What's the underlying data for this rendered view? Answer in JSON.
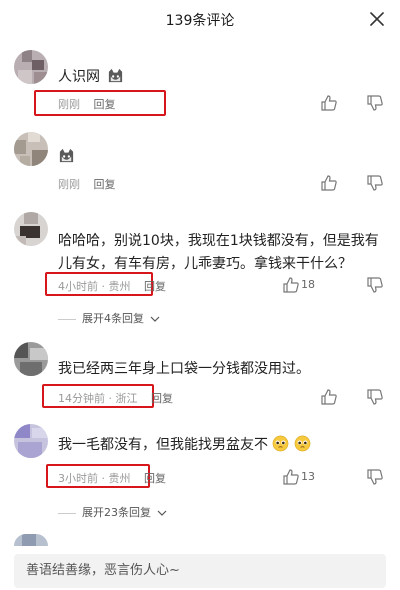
{
  "header": {
    "title": "139条评论"
  },
  "comments": [
    {
      "text": "人识网",
      "time": "刚刚",
      "reply": "回复",
      "emoji": "cat-emoji-icon"
    },
    {
      "text": "",
      "time": "刚刚",
      "reply": "回复",
      "emoji": "cat-emoji-icon"
    },
    {
      "text": "哈哈哈，别说10块，我现在1块钱都没有，但是我有儿有女，有车有房，儿乖妻巧。拿钱来干什么？",
      "time": "4小时前 · 贵州",
      "reply": "回复",
      "likes": "18",
      "expand": "展开4条回复"
    },
    {
      "text": "我已经两三年身上口袋一分钱都没用过。",
      "time": "14分钟前 · 浙江",
      "reply": "回复"
    },
    {
      "text": "我一毛都没有，但我能找男盆友不",
      "time": "3小时前 · 贵州",
      "reply": "回复",
      "likes": "13",
      "expand": "展开23条回复",
      "emoji": "pleading-face-icon"
    }
  ],
  "footer": {
    "placeholder": "善语结善缘，恶言伤人心~"
  },
  "colors": {
    "highlight": "#d6161b"
  }
}
